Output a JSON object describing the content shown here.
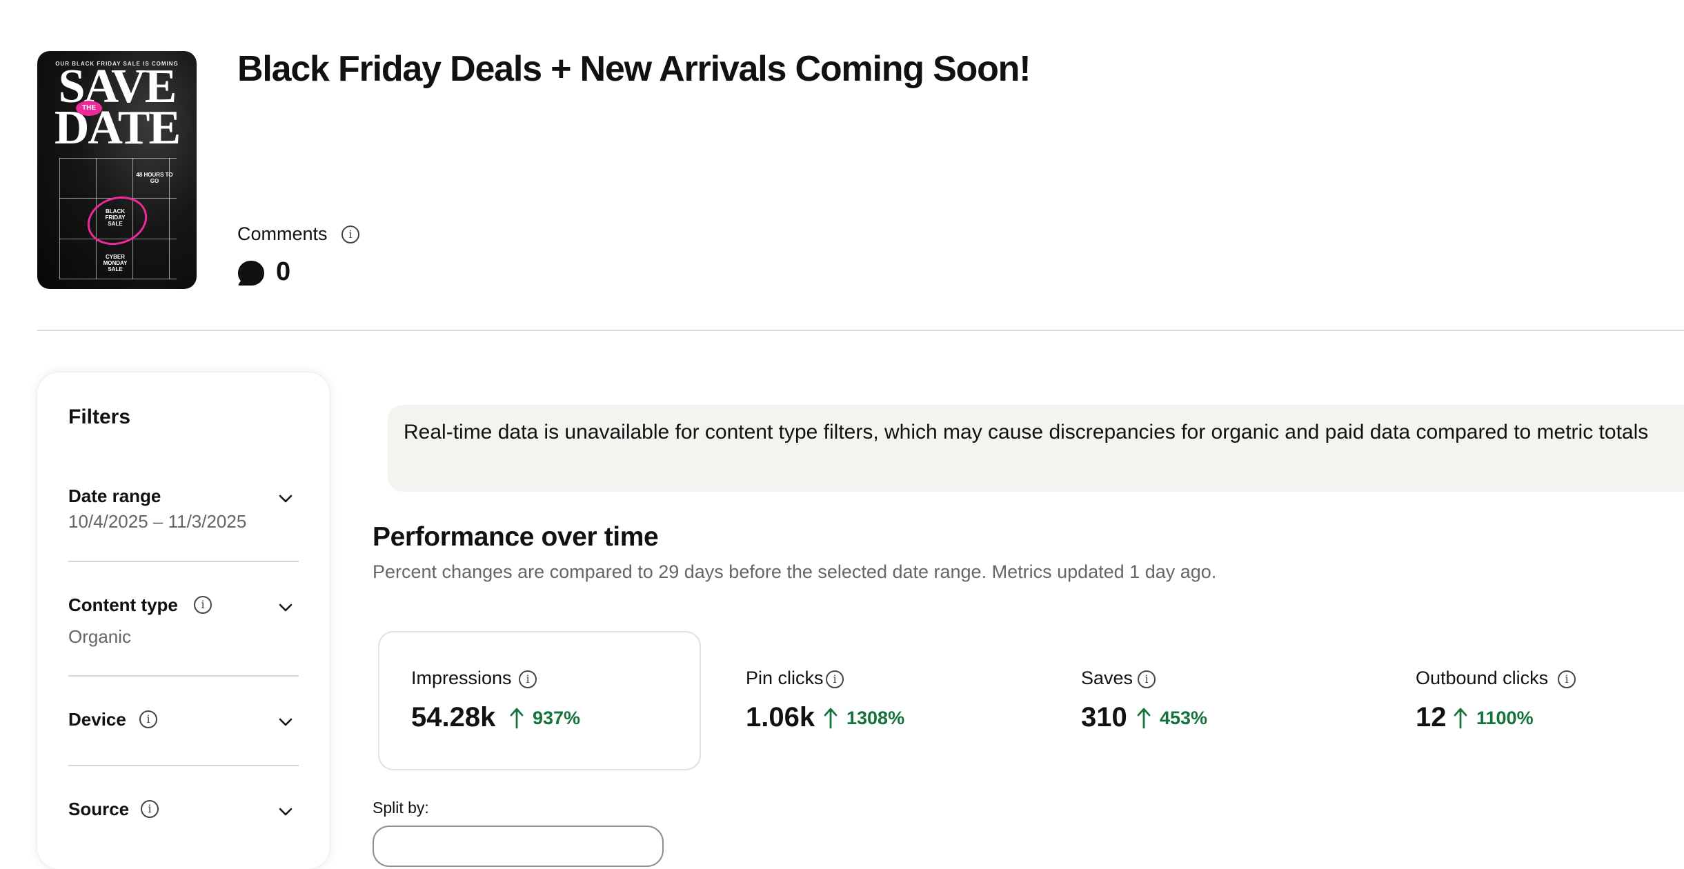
{
  "pin": {
    "title": "Black Friday Deals + New Arrivals Coming Soon!",
    "thumbnail": {
      "top_text": "OUR BLACK FRIDAY SALE IS COMING",
      "line1": "SAVE",
      "line2": "DATE",
      "badge": "THE",
      "cell_48h": "48 HOURS TO GO",
      "cell_bf": "BLACK FRIDAY SALE",
      "cell_cm": "CYBER MONDAY SALE"
    }
  },
  "comments": {
    "label": "Comments",
    "count": "0",
    "icon": "comment-bubble-icon"
  },
  "filters": {
    "title": "Filters",
    "items": [
      {
        "label": "Date range",
        "value": "10/4/2025 – 11/3/2025",
        "has_info": false
      },
      {
        "label": "Content type",
        "value": "Organic",
        "has_info": true
      },
      {
        "label": "Device",
        "value": "",
        "has_info": true
      },
      {
        "label": "Source",
        "value": "",
        "has_info": true
      }
    ]
  },
  "notice": {
    "text": "Real-time data is unavailable for content type filters, which may cause discrepancies for organic and paid data compared to metric totals"
  },
  "performance": {
    "title": "Performance over time",
    "subtitle": "Percent changes are compared to 29 days before the selected date range. Metrics updated 1 day ago.",
    "metrics": [
      {
        "label": "Impressions",
        "value": "54.28k",
        "change": "937%",
        "selected": true
      },
      {
        "label": "Pin clicks",
        "value": "1.06k",
        "change": "1308%",
        "selected": false
      },
      {
        "label": "Saves",
        "value": "310",
        "change": "453%",
        "selected": false
      },
      {
        "label": "Outbound clicks",
        "value": "12",
        "change": "1100%",
        "selected": false
      }
    ],
    "split_by_label": "Split by:"
  },
  "colors": {
    "positive": "#14733a",
    "accent_pink": "#ee2a9b",
    "notice_bg": "#f3f3f0"
  }
}
